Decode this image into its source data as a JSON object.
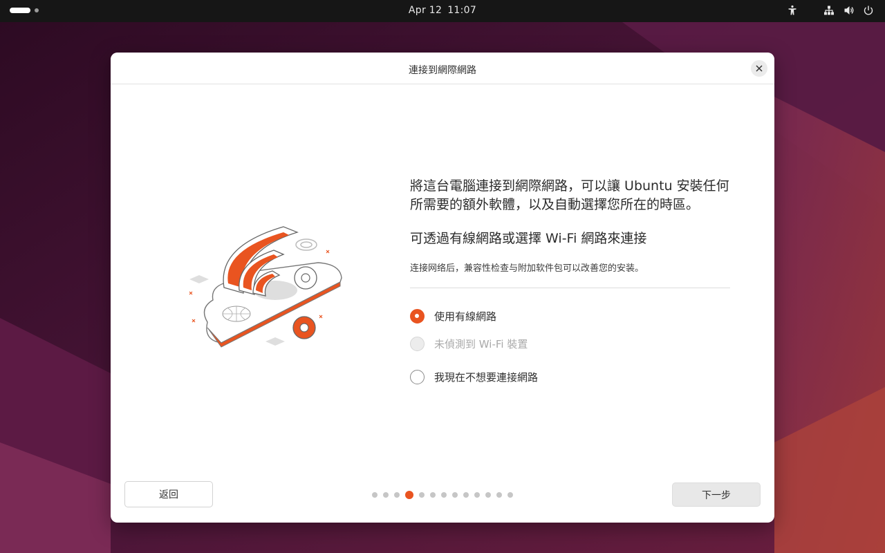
{
  "topbar": {
    "date": "Apr 12",
    "time": "11:07",
    "icons": [
      "accessibility-icon",
      "network-wired-icon",
      "volume-icon",
      "power-icon"
    ]
  },
  "dialog": {
    "title": "連接到網際網路",
    "lead": "將這台電腦連接到網際網路，可以讓 Ubuntu 安裝任何所需要的額外軟體，以及自動選擇您所在的時區。",
    "sub": "可透過有線網路或選擇 Wi-Fi 網路來連接",
    "note": "连接网络后，兼容性检查与附加软件包可以改善您的安装。",
    "options": [
      {
        "label": "使用有線網路",
        "checked": true,
        "disabled": false
      },
      {
        "label": "未偵測到 Wi-Fi 裝置",
        "checked": false,
        "disabled": true
      },
      {
        "label": "我現在不想要連接網路",
        "checked": false,
        "disabled": false
      }
    ],
    "back_label": "返回",
    "next_label": "下一步",
    "pager": {
      "total": 13,
      "current": 4
    }
  },
  "colors": {
    "accent": "#e95420",
    "topbar": "#161616",
    "wallpaper_dark": "#2c0a22",
    "wallpaper_light": "#8a2d55"
  }
}
